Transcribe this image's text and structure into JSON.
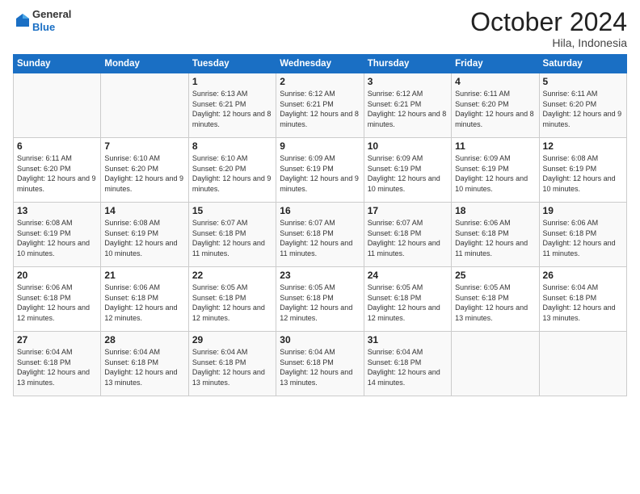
{
  "header": {
    "logo_line1": "General",
    "logo_line2": "Blue",
    "month": "October 2024",
    "location": "Hila, Indonesia"
  },
  "weekdays": [
    "Sunday",
    "Monday",
    "Tuesday",
    "Wednesday",
    "Thursday",
    "Friday",
    "Saturday"
  ],
  "weeks": [
    [
      {
        "day": "",
        "text": ""
      },
      {
        "day": "",
        "text": ""
      },
      {
        "day": "1",
        "text": "Sunrise: 6:13 AM\nSunset: 6:21 PM\nDaylight: 12 hours and 8 minutes."
      },
      {
        "day": "2",
        "text": "Sunrise: 6:12 AM\nSunset: 6:21 PM\nDaylight: 12 hours and 8 minutes."
      },
      {
        "day": "3",
        "text": "Sunrise: 6:12 AM\nSunset: 6:21 PM\nDaylight: 12 hours and 8 minutes."
      },
      {
        "day": "4",
        "text": "Sunrise: 6:11 AM\nSunset: 6:20 PM\nDaylight: 12 hours and 8 minutes."
      },
      {
        "day": "5",
        "text": "Sunrise: 6:11 AM\nSunset: 6:20 PM\nDaylight: 12 hours and 9 minutes."
      }
    ],
    [
      {
        "day": "6",
        "text": "Sunrise: 6:11 AM\nSunset: 6:20 PM\nDaylight: 12 hours and 9 minutes."
      },
      {
        "day": "7",
        "text": "Sunrise: 6:10 AM\nSunset: 6:20 PM\nDaylight: 12 hours and 9 minutes."
      },
      {
        "day": "8",
        "text": "Sunrise: 6:10 AM\nSunset: 6:20 PM\nDaylight: 12 hours and 9 minutes."
      },
      {
        "day": "9",
        "text": "Sunrise: 6:09 AM\nSunset: 6:19 PM\nDaylight: 12 hours and 9 minutes."
      },
      {
        "day": "10",
        "text": "Sunrise: 6:09 AM\nSunset: 6:19 PM\nDaylight: 12 hours and 10 minutes."
      },
      {
        "day": "11",
        "text": "Sunrise: 6:09 AM\nSunset: 6:19 PM\nDaylight: 12 hours and 10 minutes."
      },
      {
        "day": "12",
        "text": "Sunrise: 6:08 AM\nSunset: 6:19 PM\nDaylight: 12 hours and 10 minutes."
      }
    ],
    [
      {
        "day": "13",
        "text": "Sunrise: 6:08 AM\nSunset: 6:19 PM\nDaylight: 12 hours and 10 minutes."
      },
      {
        "day": "14",
        "text": "Sunrise: 6:08 AM\nSunset: 6:19 PM\nDaylight: 12 hours and 10 minutes."
      },
      {
        "day": "15",
        "text": "Sunrise: 6:07 AM\nSunset: 6:18 PM\nDaylight: 12 hours and 11 minutes."
      },
      {
        "day": "16",
        "text": "Sunrise: 6:07 AM\nSunset: 6:18 PM\nDaylight: 12 hours and 11 minutes."
      },
      {
        "day": "17",
        "text": "Sunrise: 6:07 AM\nSunset: 6:18 PM\nDaylight: 12 hours and 11 minutes."
      },
      {
        "day": "18",
        "text": "Sunrise: 6:06 AM\nSunset: 6:18 PM\nDaylight: 12 hours and 11 minutes."
      },
      {
        "day": "19",
        "text": "Sunrise: 6:06 AM\nSunset: 6:18 PM\nDaylight: 12 hours and 11 minutes."
      }
    ],
    [
      {
        "day": "20",
        "text": "Sunrise: 6:06 AM\nSunset: 6:18 PM\nDaylight: 12 hours and 12 minutes."
      },
      {
        "day": "21",
        "text": "Sunrise: 6:06 AM\nSunset: 6:18 PM\nDaylight: 12 hours and 12 minutes."
      },
      {
        "day": "22",
        "text": "Sunrise: 6:05 AM\nSunset: 6:18 PM\nDaylight: 12 hours and 12 minutes."
      },
      {
        "day": "23",
        "text": "Sunrise: 6:05 AM\nSunset: 6:18 PM\nDaylight: 12 hours and 12 minutes."
      },
      {
        "day": "24",
        "text": "Sunrise: 6:05 AM\nSunset: 6:18 PM\nDaylight: 12 hours and 12 minutes."
      },
      {
        "day": "25",
        "text": "Sunrise: 6:05 AM\nSunset: 6:18 PM\nDaylight: 12 hours and 13 minutes."
      },
      {
        "day": "26",
        "text": "Sunrise: 6:04 AM\nSunset: 6:18 PM\nDaylight: 12 hours and 13 minutes."
      }
    ],
    [
      {
        "day": "27",
        "text": "Sunrise: 6:04 AM\nSunset: 6:18 PM\nDaylight: 12 hours and 13 minutes."
      },
      {
        "day": "28",
        "text": "Sunrise: 6:04 AM\nSunset: 6:18 PM\nDaylight: 12 hours and 13 minutes."
      },
      {
        "day": "29",
        "text": "Sunrise: 6:04 AM\nSunset: 6:18 PM\nDaylight: 12 hours and 13 minutes."
      },
      {
        "day": "30",
        "text": "Sunrise: 6:04 AM\nSunset: 6:18 PM\nDaylight: 12 hours and 13 minutes."
      },
      {
        "day": "31",
        "text": "Sunrise: 6:04 AM\nSunset: 6:18 PM\nDaylight: 12 hours and 14 minutes."
      },
      {
        "day": "",
        "text": ""
      },
      {
        "day": "",
        "text": ""
      }
    ]
  ]
}
